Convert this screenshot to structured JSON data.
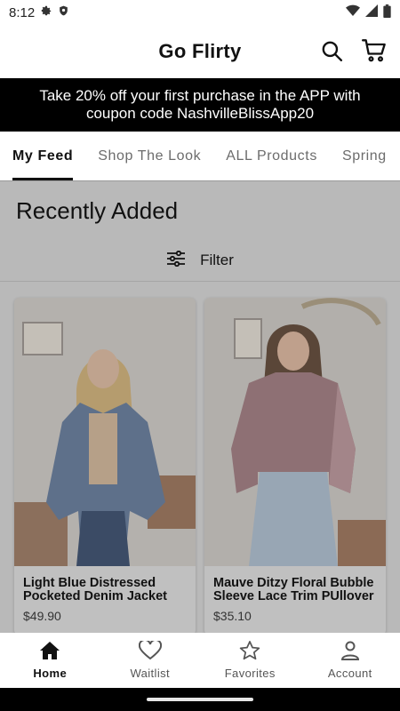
{
  "status_bar": {
    "time": "8:12",
    "icons": [
      "gear-icon",
      "shield-icon",
      "wifi-icon",
      "signal-icon",
      "battery-icon"
    ]
  },
  "app_bar": {
    "title": "Go Flirty",
    "actions": [
      "search-icon",
      "cart-icon"
    ]
  },
  "promo": {
    "text": "Take 20% off your first purchase in the APP with coupon code NashvilleBlissApp20"
  },
  "tabs": [
    {
      "label": "My Feed",
      "active": true
    },
    {
      "label": "Shop The Look",
      "active": false
    },
    {
      "label": "ALL Products",
      "active": false
    },
    {
      "label": "Spring",
      "active": false
    }
  ],
  "section": {
    "title": "Recently Added",
    "filter_label": "Filter"
  },
  "products": [
    {
      "name": "Light Blue Distressed Pocketed Denim Jacket",
      "price": "$49.90"
    },
    {
      "name": "Mauve Ditzy Floral Bubble Sleeve Lace Trim PUllover",
      "price": "$35.10"
    }
  ],
  "bottom_nav": [
    {
      "label": "Home",
      "icon": "home-icon",
      "active": true
    },
    {
      "label": "Waitlist",
      "icon": "heart-icon",
      "active": false
    },
    {
      "label": "Favorites",
      "icon": "star-icon",
      "active": false
    },
    {
      "label": "Account",
      "icon": "person-icon",
      "active": false
    }
  ],
  "colors": {
    "banner_bg": "#000000",
    "overlay": "#b9b9b9",
    "text": "#111111"
  }
}
